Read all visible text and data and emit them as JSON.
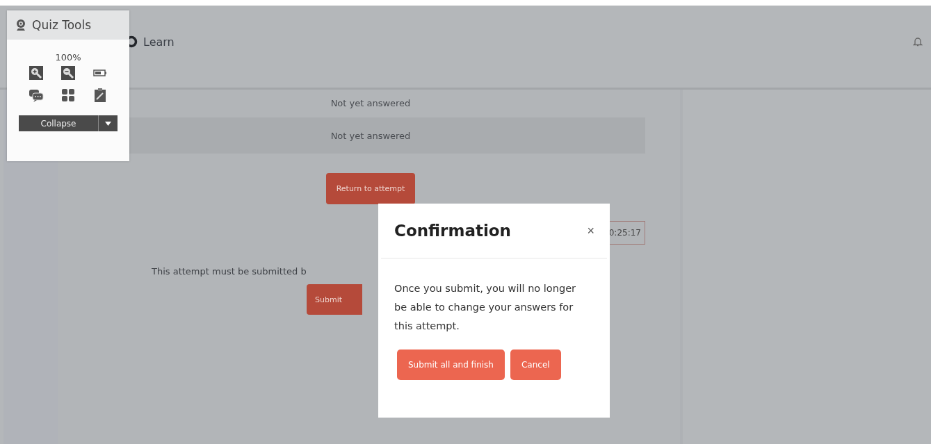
{
  "quiz_tools": {
    "title": "Quiz Tools",
    "zoom": "100%",
    "collapse_button": "Collapse"
  },
  "header": {
    "brand": "Learn"
  },
  "rows": [
    {
      "text": "Not yet answered"
    },
    {
      "text": "Not yet answered"
    }
  ],
  "return_button": "Return to attempt",
  "timer": "0:25:17",
  "notice": "This attempt must be submitted b",
  "submit_button": "Submit",
  "dialog": {
    "title": "Confirmation",
    "close": "×",
    "message": "Once you submit, you will no longer be able to change your answers for this attempt.",
    "buttons": [
      {
        "label": "Submit all and finish"
      },
      {
        "label": "Cancel"
      }
    ]
  }
}
